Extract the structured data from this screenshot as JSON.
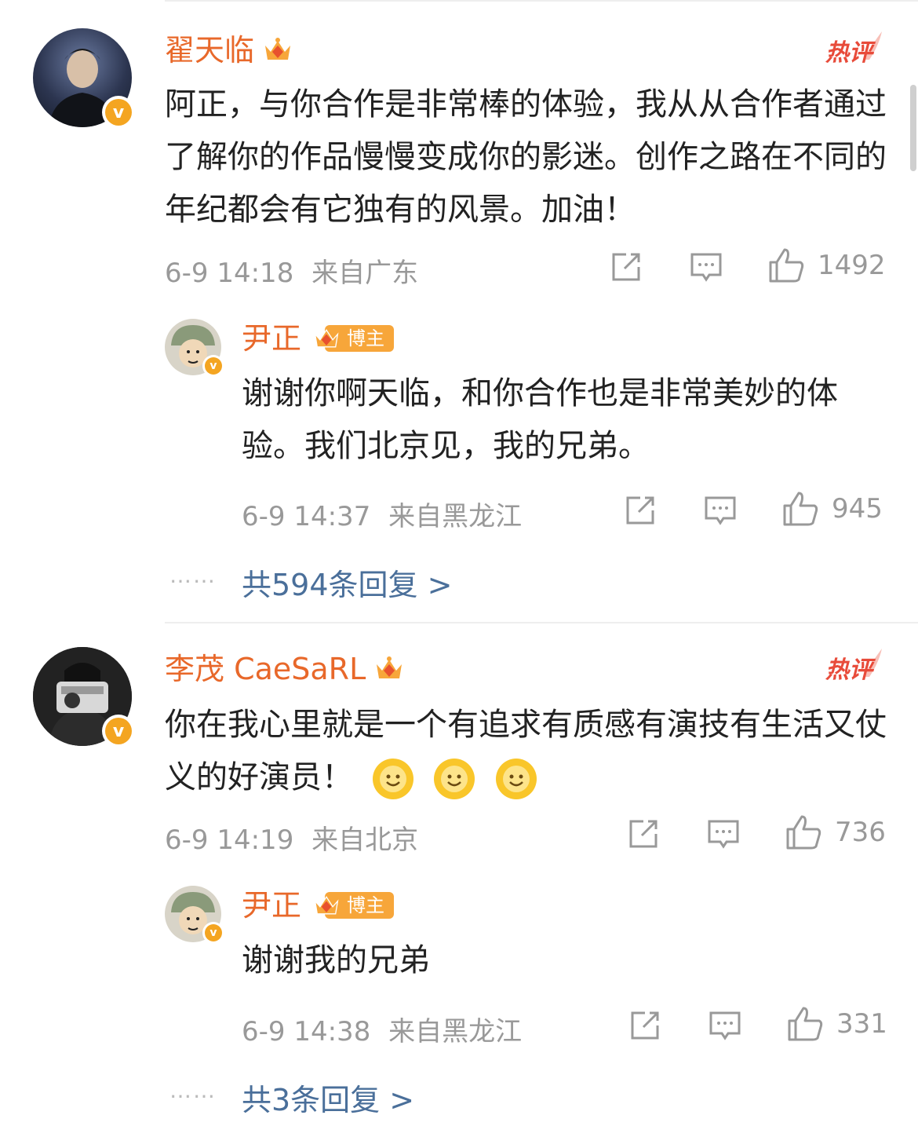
{
  "comments": [
    {
      "author": "翟天临",
      "hot_label": "热评",
      "text": "阿正，与你合作是非常棒的体验，我从从合作者通过了解你的作品慢慢变成你的影迷。创作之路在不同的年纪都会有它独有的风景。加油！",
      "time": "6-9 14:18",
      "location": "来自广东",
      "likes": "1492",
      "reply": {
        "author": "尹正",
        "badge": "博主",
        "text": "谢谢你啊天临，和你合作也是非常美妙的体验。我们北京见，我的兄弟。",
        "time": "6-9 14:37",
        "location": "来自黑龙江",
        "likes": "945"
      },
      "more_replies": "共594条回复 >",
      "dots": "……"
    },
    {
      "author": "李茂 CaeSaRL",
      "hot_label": "热评",
      "text": "你在我心里就是一个有追求有质感有演技有生活又仗义的好演员！",
      "time": "6-9 14:19",
      "location": "来自北京",
      "likes": "736",
      "reply": {
        "author": "尹正",
        "badge": "博主",
        "text": "谢谢我的兄弟",
        "time": "6-9 14:38",
        "location": "来自黑龙江",
        "likes": "331"
      },
      "more_replies": "共3条回复 >",
      "dots": "……"
    }
  ],
  "colors": {
    "name": "#e8682a",
    "link": "#4a6f9a",
    "meta": "#999999",
    "hot": "#e84b3a",
    "verified": "#f4a521"
  },
  "icons": [
    "share-icon",
    "comment-icon",
    "like-icon",
    "crown-icon",
    "verified-icon",
    "smile-emoji-icon"
  ]
}
